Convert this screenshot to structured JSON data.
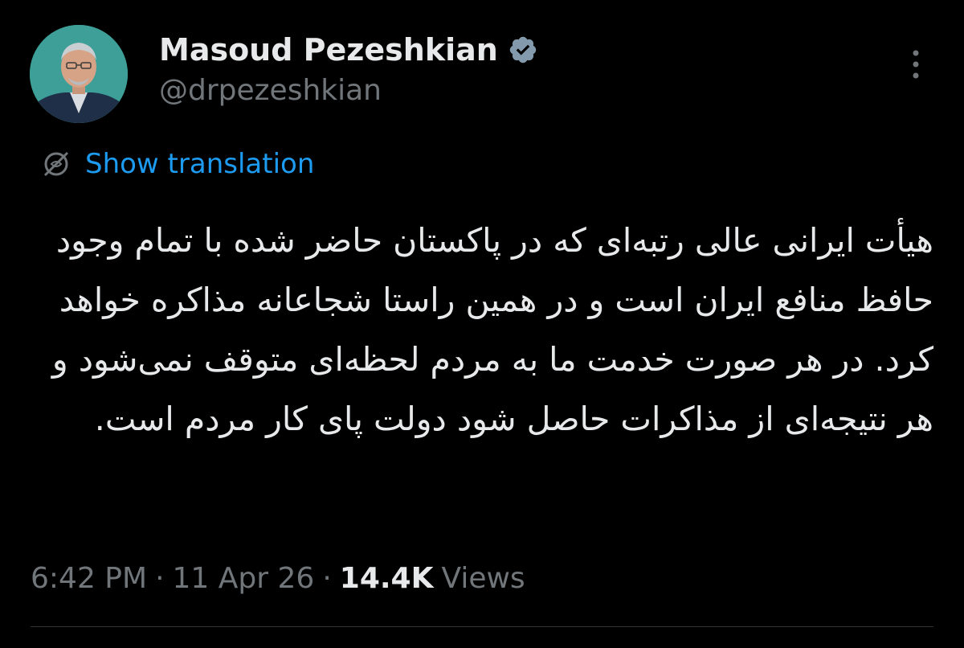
{
  "author": {
    "display_name": "Masoud Pezeshkian",
    "handle": "@drpezeshkian",
    "verified_icon": "verified-badge-icon"
  },
  "translate": {
    "label": "Show translation",
    "icon": "translate-globe-icon"
  },
  "tweet": {
    "text": "هیأت ایرانی عالی رتبه‌ای که در پاکستان حاضر شده با تمام وجود حافظ منافع ایران است و در همین راستا شجاعانه مذاکره خواهد کرد. در هر صورت خدمت ما به مردم لحظه‌ای متوقف نمی‌شود و هر نتیجه‌ای از مذاکرات حاصل شود دولت پای کار مردم است."
  },
  "meta": {
    "time": "6:42 PM",
    "separator": "·",
    "date": "11 Apr 26",
    "views_count": "14.4K",
    "views_label": "Views"
  },
  "colors": {
    "background": "#000000",
    "primary_text": "#e7e9ea",
    "secondary_text": "#71767b",
    "link": "#1d9bf0",
    "verified_badge": "#829aab",
    "divider": "#2f3336"
  }
}
